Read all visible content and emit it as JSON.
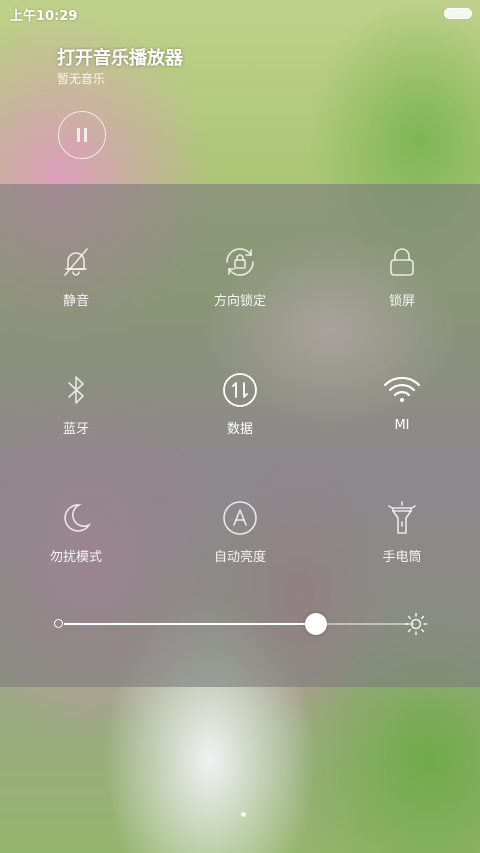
{
  "status_bar": {
    "time": "上午10:29"
  },
  "music_widget": {
    "title": "打开音乐播放器",
    "subtitle": "暂无音乐",
    "play_icon": "pause-icon"
  },
  "toggles": [
    {
      "label": "静音",
      "icon": "mute-bell-icon",
      "on": false
    },
    {
      "label": "方向锁定",
      "icon": "rotation-lock-icon",
      "on": false
    },
    {
      "label": "锁屏",
      "icon": "lock-icon",
      "on": false
    },
    {
      "label": "蓝牙",
      "icon": "bluetooth-icon",
      "on": false
    },
    {
      "label": "数据",
      "icon": "mobile-data-icon",
      "on": true
    },
    {
      "label": "MI",
      "icon": "wifi-icon",
      "on": true
    },
    {
      "label": "勿扰模式",
      "icon": "moon-icon",
      "on": false
    },
    {
      "label": "自动亮度",
      "icon": "auto-brightness-icon",
      "on": false
    },
    {
      "label": "手电筒",
      "icon": "flashlight-icon",
      "on": false
    }
  ],
  "brightness": {
    "level": 0.72,
    "icon": "sun-icon"
  },
  "colors": {
    "panel_overlay": "#7d7d7d",
    "active": "#ffffff",
    "inactive": "#e6e6e6"
  }
}
